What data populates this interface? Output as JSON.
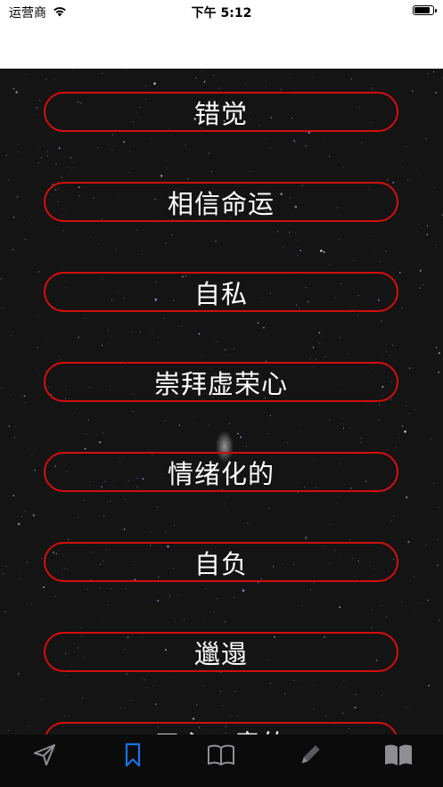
{
  "status_bar": {
    "carrier": "运营商",
    "time": "下午 5:12",
    "battery_level": 0.9
  },
  "list": {
    "items": [
      {
        "label": "错觉"
      },
      {
        "label": "相信命运"
      },
      {
        "label": "自私"
      },
      {
        "label": "崇拜虚荣心"
      },
      {
        "label": "情绪化的"
      },
      {
        "label": "自负"
      },
      {
        "label": "邋遢"
      },
      {
        "label": "三心二意的"
      }
    ]
  },
  "tab_bar": {
    "tabs": [
      {
        "icon": "send-icon",
        "active": false
      },
      {
        "icon": "bookmark-icon",
        "active": true
      },
      {
        "icon": "book-outline-icon",
        "active": false
      },
      {
        "icon": "pencil-icon",
        "active": false
      },
      {
        "icon": "book-filled-icon",
        "active": false
      }
    ],
    "active_color": "#1a73e8",
    "inactive_color": "#8e8e93"
  },
  "colors": {
    "pill_border": "#d10e0e",
    "background": "#141414"
  }
}
